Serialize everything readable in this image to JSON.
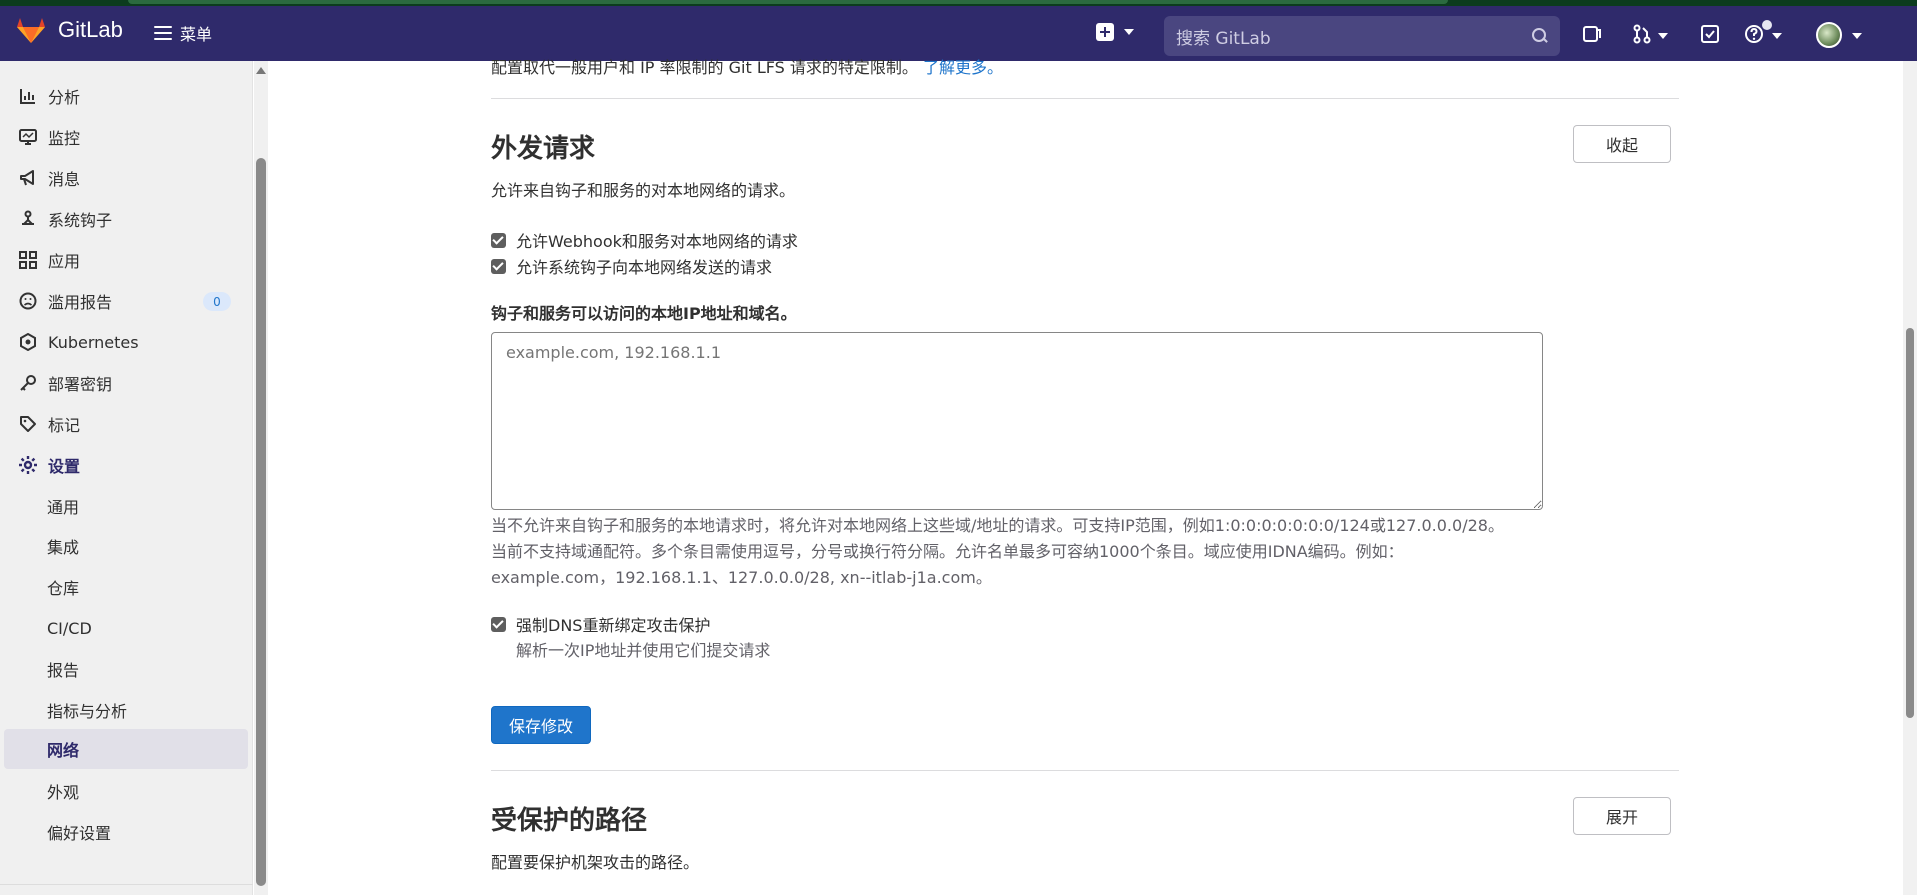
{
  "navbar": {
    "brand": "GitLab",
    "menu_label": "菜单",
    "search_placeholder": "搜索 GitLab"
  },
  "sidebar": {
    "items": [
      {
        "label": "分析",
        "icon": "chart-icon"
      },
      {
        "label": "监控",
        "icon": "monitor-icon"
      },
      {
        "label": "消息",
        "icon": "bullhorn-icon"
      },
      {
        "label": "系统钩子",
        "icon": "hook-icon"
      },
      {
        "label": "应用",
        "icon": "apps-icon"
      },
      {
        "label": "滥用报告",
        "icon": "abuse-icon",
        "badge": "0"
      },
      {
        "label": "Kubernetes",
        "icon": "kubernetes-icon"
      },
      {
        "label": "部署密钥",
        "icon": "key-icon"
      },
      {
        "label": "标记",
        "icon": "label-icon"
      },
      {
        "label": "设置",
        "icon": "gear-icon"
      }
    ],
    "settings_sub": [
      {
        "label": "通用"
      },
      {
        "label": "集成"
      },
      {
        "label": "仓库"
      },
      {
        "label": "CI/CD"
      },
      {
        "label": "报告"
      },
      {
        "label": "指标与分析"
      },
      {
        "label": "网络"
      },
      {
        "label": "外观"
      },
      {
        "label": "偏好设置"
      }
    ]
  },
  "main": {
    "top_partial_text": "配置取代一般用户和 IP 率限制的 Git LFS 请求的特定限制。",
    "top_partial_link": "了解更多。",
    "outbound": {
      "title": "外发请求",
      "collapse_label": "收起",
      "description": "允许来自钩子和服务的对本地网络的请求。",
      "check_webhook": "允许Webhook和服务对本地网络的请求",
      "check_system_hooks": "允许系统钩子向本地网络发送的请求",
      "field_label": "钩子和服务可以访问的本地IP地址和域名。",
      "textarea_placeholder": "example.com, 192.168.1.1",
      "help_line1": "当不允许来自钩子和服务的本地请求时，将允许对本地网络上这些域/地址的请求。可支持IP范围，例如1:0:0:0:0:0:0:0/124或127.0.0.0/28。",
      "help_line2": "当前不支持域通配符。多个条目需使用逗号，分号或换行符分隔。允许名单最多可容纳1000个条目。域应使用IDNA编码。例如：",
      "help_line3": "example.com，192.168.1.1、127.0.0.0/28, xn--itlab-j1a.com。",
      "check_dns": "强制DNS重新绑定攻击保护",
      "dns_help": "解析一次IP地址并使用它们提交请求",
      "save_label": "保存修改"
    },
    "protected_paths": {
      "title": "受保护的路径",
      "expand_label": "展开",
      "description": "配置要保护机架攻击的路径。"
    }
  }
}
